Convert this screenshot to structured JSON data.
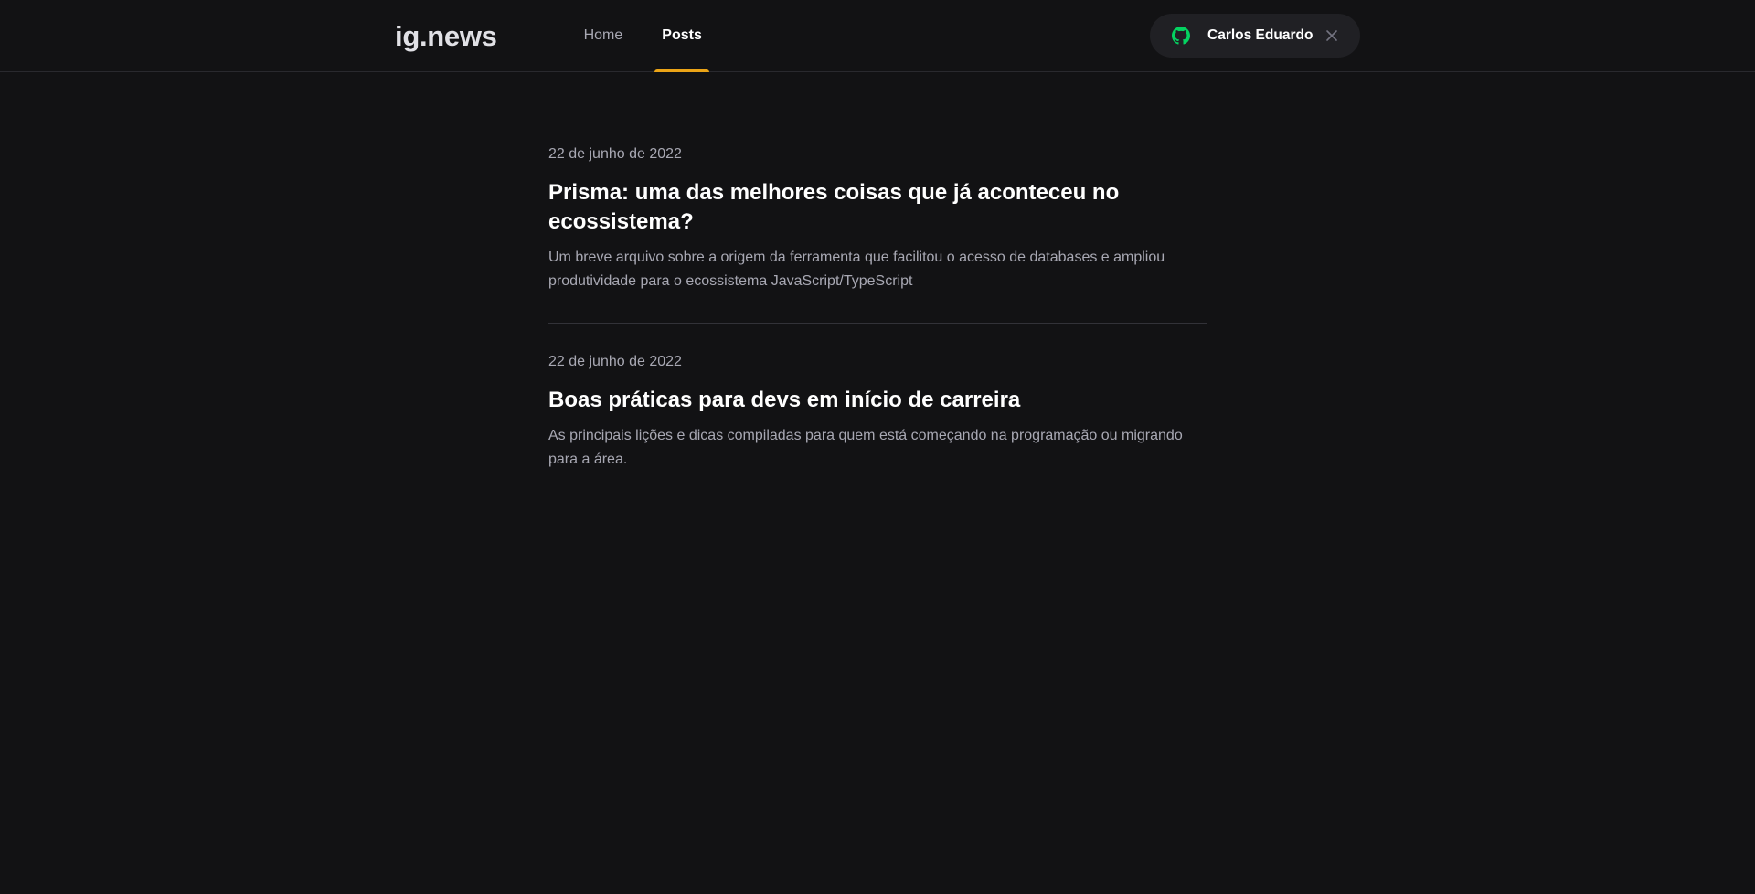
{
  "header": {
    "logo": "ig.news",
    "nav": [
      {
        "label": "Home",
        "active": false
      },
      {
        "label": "Posts",
        "active": true
      }
    ],
    "user": {
      "name": "Carlos Eduardo",
      "icon": "github-icon",
      "icon_color": "#04d361",
      "close_icon": "close-icon"
    },
    "accent_color": "#eba417"
  },
  "posts": [
    {
      "date": "22 de junho de 2022",
      "title": "Prisma: uma das melhores coisas que já aconteceu no ecossistema?",
      "excerpt": "Um breve arquivo sobre a origem da ferramenta que facilitou o acesso de databases e ampliou produtividade para o ecossistema JavaScript/TypeScript"
    },
    {
      "date": "22 de junho de 2022",
      "title": "Boas práticas para devs em início de carreira",
      "excerpt": "As principais lições e dicas compiladas para quem está começando na programação ou migrando para a área."
    }
  ]
}
